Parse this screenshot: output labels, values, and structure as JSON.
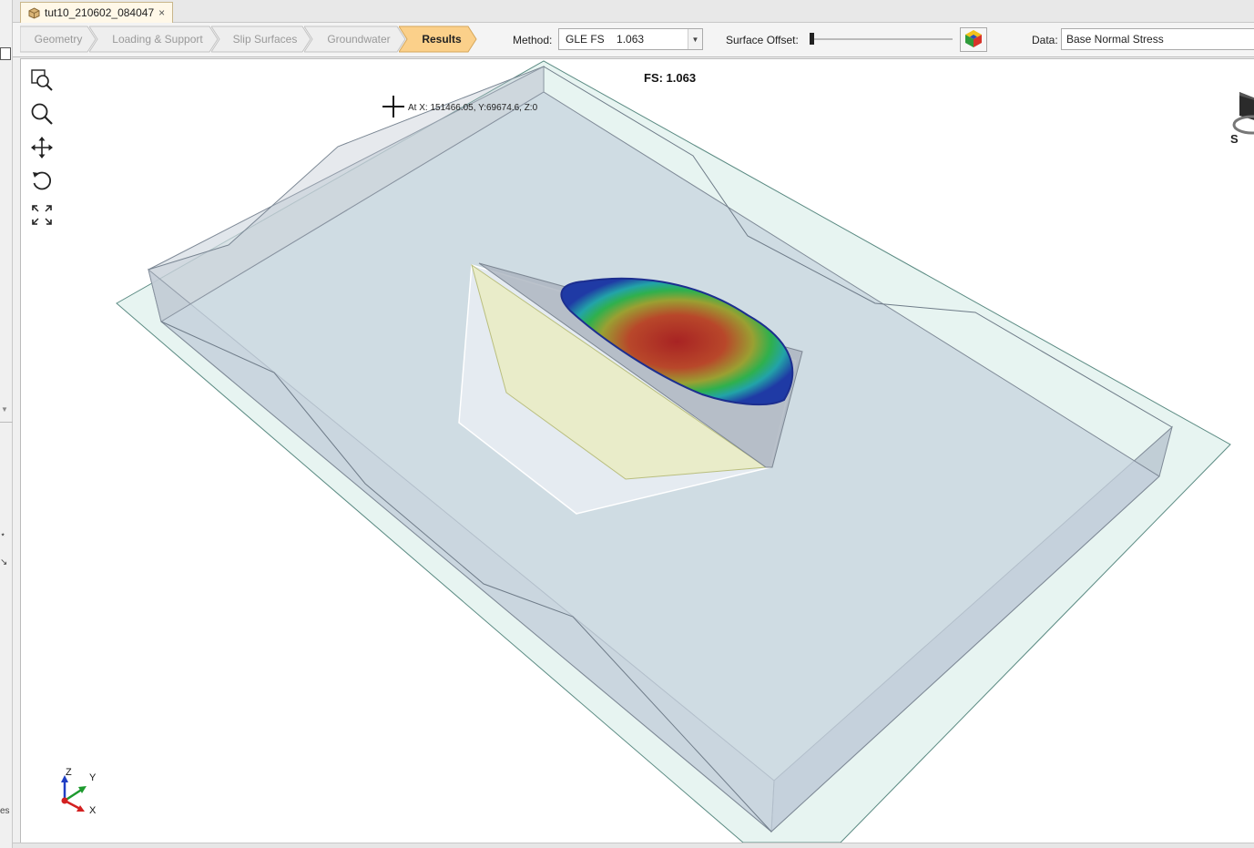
{
  "document_tab": {
    "label": "tut10_210602_084047",
    "close": "×"
  },
  "workflow_steps": [
    {
      "label": "Geometry",
      "active": false
    },
    {
      "label": "Loading & Support",
      "active": false
    },
    {
      "label": "Slip Surfaces",
      "active": false
    },
    {
      "label": "Groundwater",
      "active": false
    },
    {
      "label": "Results",
      "active": true
    }
  ],
  "toolbar": {
    "method_label": "Method:",
    "method_value": "GLE FS    1.063",
    "surface_offset_label": "Surface Offset:",
    "surface_offset_level": 0,
    "data_label": "Data:",
    "data_value": "Base Normal Stress"
  },
  "viewport": {
    "fs_title": "FS: 1.063",
    "coord_readout": "At X: 151466.05, Y:69674.6, Z:0",
    "axis_labels": {
      "z": "Z",
      "y": "Y",
      "x": "X"
    },
    "view_cube_label": "S"
  },
  "view_tools": [
    {
      "name": "zoom-window-icon"
    },
    {
      "name": "zoom-icon"
    },
    {
      "name": "pan-icon"
    },
    {
      "name": "rotate-icon"
    },
    {
      "name": "zoom-extents-icon"
    }
  ],
  "left_strip": {
    "fragment_bottom": "es"
  },
  "colors": {
    "active_step": "#fbd08a",
    "contour_high": "#a82323",
    "contour_low": "#1f3aa5",
    "slab_fill": "#c6d3de",
    "plane_fill": "#dff0ec"
  }
}
